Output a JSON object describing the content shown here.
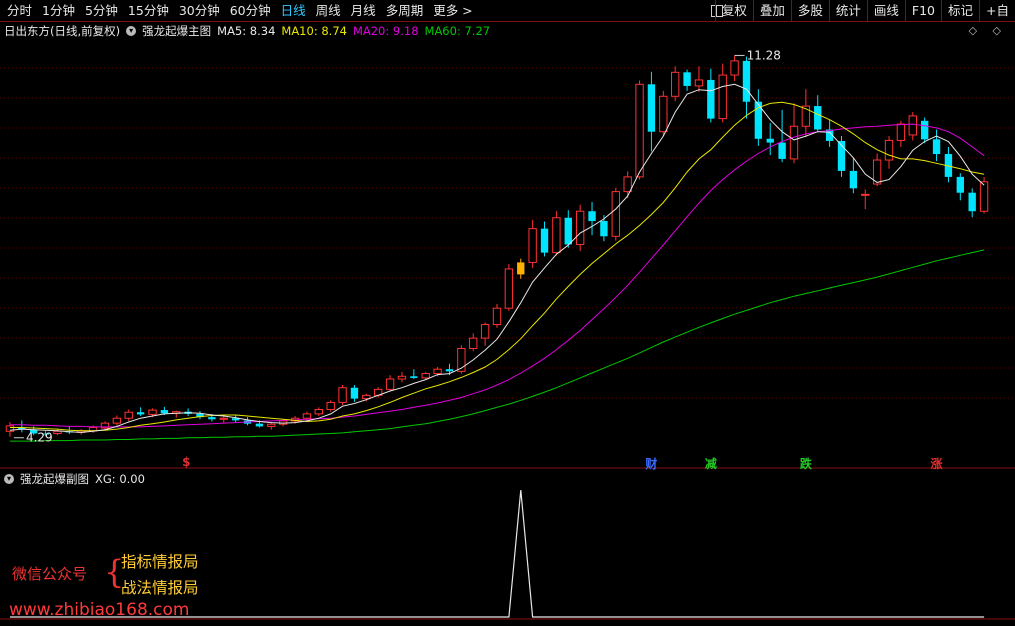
{
  "toolbar": {
    "tabs": [
      "分时",
      "1分钟",
      "5分钟",
      "15分钟",
      "30分钟",
      "60分钟",
      "日线",
      "周线",
      "月线",
      "多周期",
      "更多 >"
    ],
    "active_tab": "日线",
    "tools": [
      "复权",
      "叠加",
      "多股",
      "统计",
      "画线",
      "F10",
      "标记",
      "+自"
    ]
  },
  "main_panel": {
    "stock_title": "日出东方(日线,前复权)",
    "indicator_name": "强龙起爆主图",
    "ma5_label": "MA5: 8.34",
    "ma10_label": "MA10: 8.74",
    "ma20_label": "MA20: 9.18",
    "ma60_label": "MA60: 7.27",
    "max_label": "11.28",
    "min_label": "4.29",
    "nav": "◇ ◇"
  },
  "signals": [
    {
      "text": "$",
      "color": "#e03030"
    },
    {
      "text": "财",
      "color": "#3a6cff"
    },
    {
      "text": "减",
      "color": "#22cc22"
    },
    {
      "text": "跌",
      "color": "#22cc22"
    },
    {
      "text": "涨",
      "color": "#e03030"
    }
  ],
  "sub_panel": {
    "indicator_name": "强龙起爆副图",
    "xg_label": "XG: 0.00"
  },
  "watermark": {
    "line1": "微信公众号",
    "line2": "指标情报局",
    "line3": "战法情报局",
    "url": "www.zhibiao168.com"
  },
  "colors": {
    "up": "#ff3232",
    "down": "#00e5ff",
    "ma5": "#e8e8e8",
    "ma10": "#e8e800",
    "ma20": "#e000e0",
    "ma60": "#00c800",
    "special": "#ffb000"
  },
  "chart_data": {
    "type": "candlestick",
    "price_range": [
      4.0,
      11.6
    ],
    "candles": [
      [
        4.38,
        4.55,
        4.28,
        4.48
      ],
      [
        4.45,
        4.58,
        4.36,
        4.42
      ],
      [
        4.41,
        4.47,
        4.31,
        4.34
      ],
      [
        4.34,
        4.38,
        4.29,
        4.33
      ],
      [
        4.34,
        4.43,
        4.31,
        4.38
      ],
      [
        4.38,
        4.48,
        4.33,
        4.36
      ],
      [
        4.36,
        4.42,
        4.32,
        4.39
      ],
      [
        4.39,
        4.49,
        4.35,
        4.45
      ],
      [
        4.44,
        4.56,
        4.4,
        4.53
      ],
      [
        4.53,
        4.67,
        4.49,
        4.62
      ],
      [
        4.62,
        4.78,
        4.57,
        4.73
      ],
      [
        4.73,
        4.82,
        4.66,
        4.69
      ],
      [
        4.69,
        4.8,
        4.64,
        4.77
      ],
      [
        4.77,
        4.83,
        4.68,
        4.71
      ],
      [
        4.71,
        4.76,
        4.63,
        4.74
      ],
      [
        4.74,
        4.8,
        4.66,
        4.7
      ],
      [
        4.7,
        4.75,
        4.6,
        4.64
      ],
      [
        4.64,
        4.7,
        4.56,
        4.6
      ],
      [
        4.6,
        4.66,
        4.52,
        4.62
      ],
      [
        4.62,
        4.68,
        4.54,
        4.58
      ],
      [
        4.58,
        4.64,
        4.49,
        4.52
      ],
      [
        4.52,
        4.58,
        4.45,
        4.47
      ],
      [
        4.47,
        4.55,
        4.41,
        4.51
      ],
      [
        4.51,
        4.6,
        4.47,
        4.57
      ],
      [
        4.57,
        4.66,
        4.52,
        4.62
      ],
      [
        4.62,
        4.74,
        4.58,
        4.7
      ],
      [
        4.7,
        4.82,
        4.66,
        4.78
      ],
      [
        4.78,
        4.95,
        4.74,
        4.91
      ],
      [
        4.91,
        5.23,
        4.86,
        5.18
      ],
      [
        5.18,
        5.23,
        4.92,
        4.98
      ],
      [
        4.98,
        5.07,
        4.93,
        5.04
      ],
      [
        5.04,
        5.19,
        5.0,
        5.15
      ],
      [
        5.15,
        5.41,
        5.11,
        5.34
      ],
      [
        5.34,
        5.47,
        5.28,
        5.39
      ],
      [
        5.39,
        5.52,
        5.34,
        5.36
      ],
      [
        5.36,
        5.47,
        5.32,
        5.44
      ],
      [
        5.44,
        5.56,
        5.39,
        5.52
      ],
      [
        5.52,
        5.62,
        5.41,
        5.48
      ],
      [
        5.48,
        5.96,
        5.44,
        5.9
      ],
      [
        5.9,
        6.18,
        5.85,
        6.09
      ],
      [
        6.09,
        6.38,
        5.95,
        6.34
      ],
      [
        6.34,
        6.72,
        6.28,
        6.64
      ],
      [
        6.64,
        7.45,
        6.59,
        7.36
      ],
      [
        7.26,
        7.55,
        7.18,
        7.48
      ],
      [
        7.48,
        8.26,
        7.38,
        8.1
      ],
      [
        8.1,
        8.23,
        7.59,
        7.66
      ],
      [
        7.66,
        8.42,
        7.61,
        8.3
      ],
      [
        8.3,
        8.44,
        7.75,
        7.81
      ],
      [
        7.81,
        8.54,
        7.69,
        8.42
      ],
      [
        8.42,
        8.59,
        7.98,
        8.24
      ],
      [
        8.24,
        8.35,
        7.87,
        7.96
      ],
      [
        7.96,
        8.85,
        7.88,
        8.78
      ],
      [
        8.78,
        9.15,
        8.66,
        9.05
      ],
      [
        9.05,
        10.82,
        9.0,
        10.75
      ],
      [
        10.75,
        10.98,
        9.52,
        9.88
      ],
      [
        9.88,
        10.63,
        9.81,
        10.53
      ],
      [
        10.53,
        11.08,
        10.44,
        10.97
      ],
      [
        10.97,
        11.02,
        10.63,
        10.72
      ],
      [
        10.72,
        11.08,
        10.61,
        10.83
      ],
      [
        10.83,
        11.04,
        10.05,
        10.12
      ],
      [
        10.12,
        11.13,
        10.05,
        10.92
      ],
      [
        10.92,
        11.28,
        10.81,
        11.18
      ],
      [
        11.18,
        11.26,
        10.12,
        10.43
      ],
      [
        10.43,
        10.66,
        9.62,
        9.75
      ],
      [
        9.75,
        10.04,
        9.45,
        9.68
      ],
      [
        9.68,
        10.28,
        9.32,
        9.38
      ],
      [
        9.38,
        10.4,
        9.3,
        9.98
      ],
      [
        9.98,
        10.66,
        9.78,
        10.35
      ],
      [
        10.35,
        10.55,
        9.88,
        9.92
      ],
      [
        9.92,
        10.1,
        9.6,
        9.71
      ],
      [
        9.71,
        9.8,
        9.05,
        9.16
      ],
      [
        9.16,
        9.4,
        8.75,
        8.84
      ],
      [
        8.72,
        8.82,
        8.46,
        8.73
      ],
      [
        8.92,
        9.48,
        8.88,
        9.36
      ],
      [
        9.36,
        9.8,
        9.2,
        9.72
      ],
      [
        9.72,
        10.08,
        9.6,
        10.02
      ],
      [
        9.82,
        10.24,
        9.72,
        10.17
      ],
      [
        10.08,
        10.14,
        9.67,
        9.74
      ],
      [
        9.74,
        9.92,
        9.34,
        9.47
      ],
      [
        9.47,
        9.6,
        8.95,
        9.05
      ],
      [
        9.05,
        9.12,
        8.62,
        8.76
      ],
      [
        8.76,
        8.84,
        8.31,
        8.42
      ],
      [
        8.42,
        9.05,
        8.38,
        8.96
      ]
    ],
    "ma5": [
      4.4,
      4.42,
      4.41,
      4.4,
      4.39,
      4.37,
      4.36,
      4.38,
      4.41,
      4.47,
      4.55,
      4.62,
      4.66,
      4.7,
      4.71,
      4.72,
      4.71,
      4.68,
      4.66,
      4.63,
      4.59,
      4.56,
      4.54,
      4.53,
      4.54,
      4.57,
      4.62,
      4.7,
      4.84,
      4.89,
      4.96,
      5.04,
      5.12,
      5.18,
      5.26,
      5.33,
      5.42,
      5.44,
      5.54,
      5.69,
      5.87,
      6.07,
      6.39,
      6.74,
      7.12,
      7.38,
      7.63,
      7.8,
      8.02,
      8.14,
      8.28,
      8.46,
      8.7,
      9.14,
      9.48,
      9.8,
      10.24,
      10.57,
      10.65,
      10.63,
      10.71,
      10.75,
      10.66,
      10.38,
      10.1,
      9.88,
      9.73,
      9.8,
      9.88,
      9.87,
      9.63,
      9.4,
      9.1,
      8.95,
      9.0,
      9.24,
      9.54,
      9.7,
      9.8,
      9.7,
      9.43,
      9.1,
      8.9
    ],
    "ma10": [
      4.45,
      4.45,
      4.44,
      4.43,
      4.42,
      4.4,
      4.39,
      4.39,
      4.4,
      4.42,
      4.45,
      4.49,
      4.52,
      4.55,
      4.59,
      4.62,
      4.65,
      4.67,
      4.68,
      4.68,
      4.66,
      4.64,
      4.62,
      4.6,
      4.58,
      4.56,
      4.57,
      4.6,
      4.66,
      4.7,
      4.76,
      4.83,
      4.91,
      5.0,
      5.08,
      5.16,
      5.22,
      5.29,
      5.37,
      5.46,
      5.56,
      5.7,
      5.88,
      6.08,
      6.32,
      6.55,
      6.81,
      7.04,
      7.26,
      7.46,
      7.64,
      7.82,
      7.98,
      8.16,
      8.36,
      8.58,
      8.85,
      9.14,
      9.38,
      9.55,
      9.78,
      10.0,
      10.18,
      10.32,
      10.4,
      10.42,
      10.38,
      10.3,
      10.2,
      10.1,
      9.98,
      9.84,
      9.68,
      9.55,
      9.45,
      9.38,
      9.38,
      9.35,
      9.3,
      9.25,
      9.2,
      9.14,
      9.1
    ],
    "ma20": [
      4.5,
      4.5,
      4.49,
      4.49,
      4.48,
      4.47,
      4.47,
      4.46,
      4.46,
      4.46,
      4.46,
      4.46,
      4.47,
      4.48,
      4.49,
      4.5,
      4.51,
      4.52,
      4.53,
      4.54,
      4.55,
      4.56,
      4.57,
      4.58,
      4.59,
      4.6,
      4.61,
      4.62,
      4.64,
      4.66,
      4.69,
      4.72,
      4.75,
      4.78,
      4.82,
      4.86,
      4.9,
      4.95,
      5.0,
      5.07,
      5.14,
      5.23,
      5.33,
      5.45,
      5.58,
      5.72,
      5.88,
      6.05,
      6.23,
      6.43,
      6.63,
      6.84,
      7.06,
      7.3,
      7.55,
      7.8,
      8.06,
      8.32,
      8.57,
      8.8,
      9.0,
      9.18,
      9.34,
      9.48,
      9.6,
      9.7,
      9.78,
      9.84,
      9.88,
      9.9,
      9.93,
      9.95,
      9.97,
      9.98,
      10.0,
      10.01,
      10.02,
      9.99,
      9.95,
      9.88,
      9.76,
      9.6,
      9.44
    ],
    "ma60": [
      4.2,
      4.2,
      4.2,
      4.21,
      4.21,
      4.21,
      4.22,
      4.22,
      4.22,
      4.23,
      4.23,
      4.24,
      4.24,
      4.25,
      4.25,
      4.26,
      4.26,
      4.27,
      4.27,
      4.28,
      4.28,
      4.29,
      4.29,
      4.3,
      4.31,
      4.32,
      4.33,
      4.34,
      4.35,
      4.37,
      4.39,
      4.41,
      4.43,
      4.46,
      4.49,
      4.52,
      4.56,
      4.6,
      4.65,
      4.7,
      4.76,
      4.82,
      4.88,
      4.95,
      5.02,
      5.1,
      5.18,
      5.27,
      5.36,
      5.45,
      5.54,
      5.63,
      5.72,
      5.82,
      5.92,
      6.02,
      6.11,
      6.2,
      6.29,
      6.37,
      6.45,
      6.53,
      6.6,
      6.67,
      6.74,
      6.8,
      6.86,
      6.91,
      6.96,
      7.01,
      7.06,
      7.11,
      7.16,
      7.21,
      7.27,
      7.33,
      7.39,
      7.45,
      7.51,
      7.56,
      7.61,
      7.66,
      7.71
    ],
    "special_candle_index": 43,
    "xg_values": [
      0,
      0,
      0,
      0,
      0,
      0,
      0,
      0,
      0,
      0,
      0,
      0,
      0,
      0,
      0,
      0,
      0,
      0,
      0,
      0,
      0,
      0,
      0,
      0,
      0,
      0,
      0,
      0,
      0,
      0,
      0,
      0,
      0,
      0,
      0,
      0,
      0,
      0,
      0,
      0,
      0,
      0,
      0,
      1,
      0,
      0,
      0,
      0,
      0,
      0,
      0,
      0,
      0,
      0,
      0,
      0,
      0,
      0,
      0,
      0,
      0,
      0,
      0,
      0,
      0,
      0,
      0,
      0,
      0,
      0,
      0,
      0,
      0,
      0,
      0,
      0,
      0,
      0,
      0,
      0,
      0,
      0,
      0
    ]
  }
}
